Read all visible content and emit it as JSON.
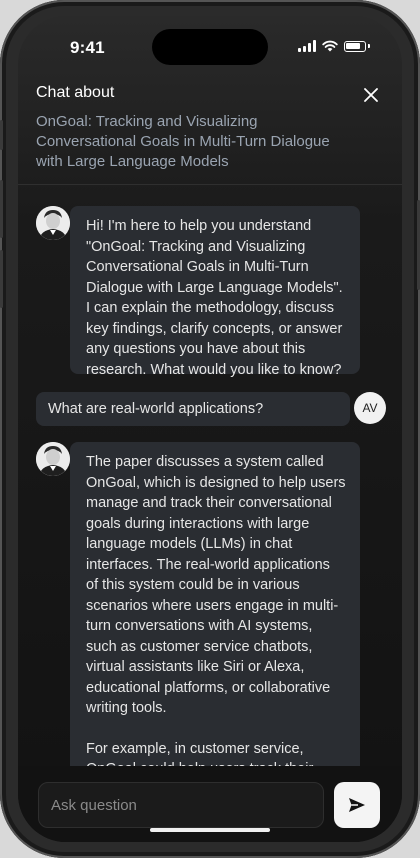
{
  "status_bar": {
    "time": "9:41"
  },
  "header": {
    "label": "Chat about",
    "paper_title": "OnGoal: Tracking and Visualizing Conversational Goals in Multi-Turn Dialogue with Large Language Models",
    "close_icon": "close-icon"
  },
  "messages": {
    "bot_1": "Hi! I'm here to help you understand \"OnGoal: Tracking and Visualizing Conversational Goals in Multi-Turn Dialogue with Large Language Models\". I can explain the methodology, discuss key findings, clarify concepts, or answer any questions you have about this research. What would you like to know?",
    "user_1": "What are real-world applications?",
    "user_avatar_initials": "AV",
    "bot_2_p1": "The paper discusses a system called OnGoal, which is designed to help users manage and track their conversational goals during interactions with large language models (LLMs) in chat interfaces. The real-world applications of this system could be in various scenarios where users engage in multi-turn conversations with AI systems, such as customer service chatbots, virtual assistants like Siri or Alexa, educational platforms, or collaborative writing tools.",
    "bot_2_p2": "For example, in customer service, OnGoal could help users track their requests and ensure that the AI system addresses their concerns effectively over multiple interactions. In educational platforms, it could help students keep track of learning goals."
  },
  "composer": {
    "placeholder": "Ask question",
    "send_icon": "send-icon"
  }
}
